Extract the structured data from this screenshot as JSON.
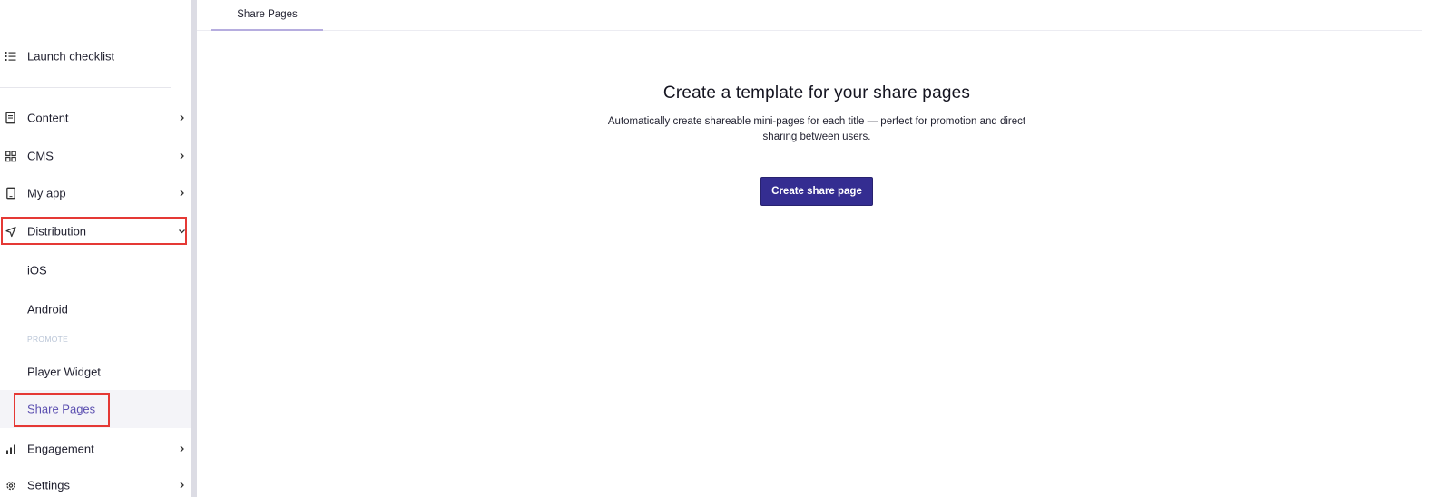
{
  "sidebar": {
    "launch_checklist": "Launch checklist",
    "items": [
      {
        "label": "Content",
        "icon": "document-icon"
      },
      {
        "label": "CMS",
        "icon": "grid-icon"
      },
      {
        "label": "My app",
        "icon": "phone-icon"
      },
      {
        "label": "Distribution",
        "icon": "send-icon",
        "expanded": true
      },
      {
        "label": "Engagement",
        "icon": "bar-chart-icon"
      },
      {
        "label": "Settings",
        "icon": "gear-icon"
      }
    ],
    "distribution_sub": [
      "iOS",
      "Android"
    ],
    "promote_label": "PROMOTE",
    "promote_sub": [
      "Player Widget",
      "Share Pages"
    ],
    "active_item": "Share Pages"
  },
  "tabs": [
    {
      "label": "Share Pages",
      "active": true
    }
  ],
  "empty_state": {
    "title": "Create a template for your share pages",
    "description": "Automatically create shareable mini-pages for each title — perfect for promotion and direct sharing between users.",
    "button_label": "Create share page"
  },
  "colors": {
    "primary": "#342d91",
    "active_text": "#5b4fb0",
    "highlight": "#e53935"
  }
}
